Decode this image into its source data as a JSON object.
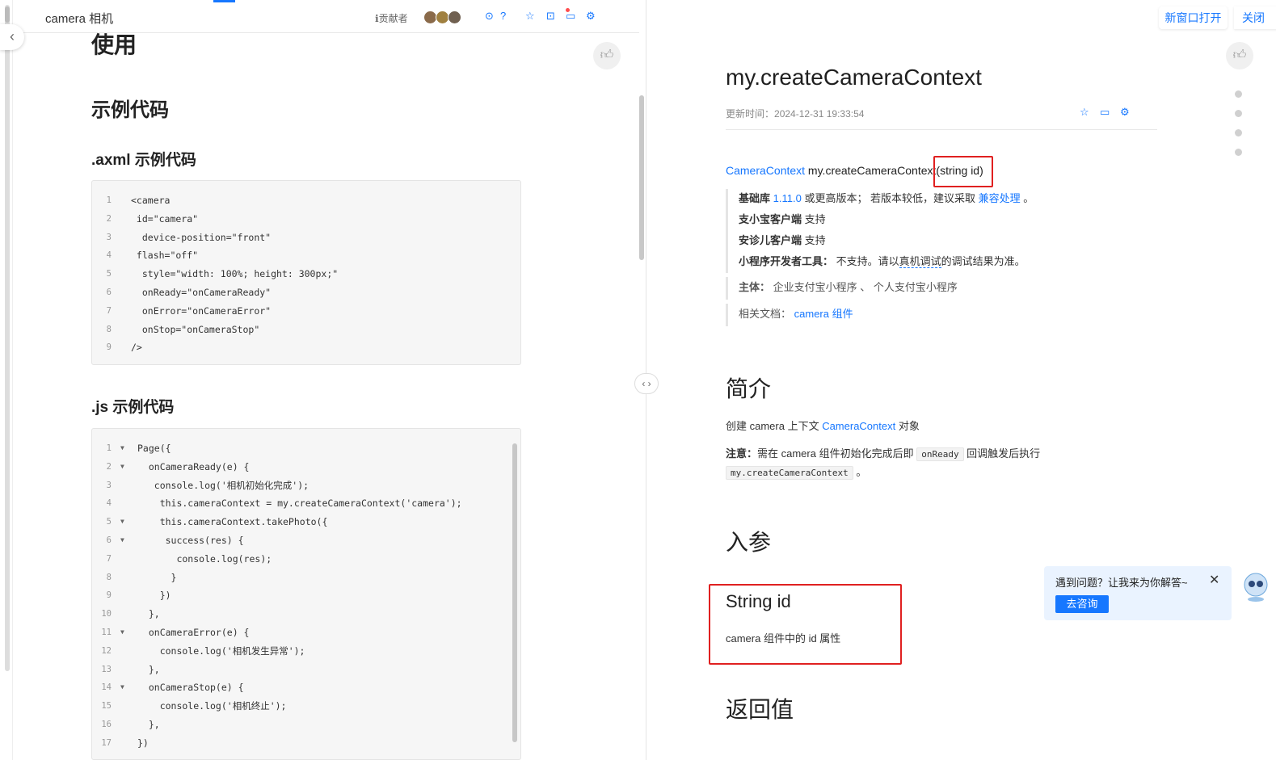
{
  "left": {
    "title": "camera 相机",
    "contributors_label": "贡献者",
    "heading_use": "使用",
    "heading_example": "示例代码",
    "heading_axml": ".axml 示例代码",
    "heading_js": ".js 示例代码",
    "axml_code": [
      {
        "n": "1",
        "text": "<camera"
      },
      {
        "n": "2",
        "text": " id=\"camera\""
      },
      {
        "n": "3",
        "text": "  device-position=\"front\""
      },
      {
        "n": "4",
        "text": " flash=\"off\""
      },
      {
        "n": "5",
        "text": "  style=\"width: 100%; height: 300px;\""
      },
      {
        "n": "6",
        "text": "  onReady=\"onCameraReady\""
      },
      {
        "n": "7",
        "text": "  onError=\"onCameraError\""
      },
      {
        "n": "8",
        "text": "  onStop=\"onCameraStop\""
      },
      {
        "n": "9",
        "text": "/>"
      }
    ],
    "js_code": [
      {
        "n": "1",
        "fold": true,
        "text": "Page({"
      },
      {
        "n": "2",
        "fold": true,
        "text": "  onCameraReady(e) {"
      },
      {
        "n": "3",
        "fold": false,
        "text": "   console.log('相机初始化完成');"
      },
      {
        "n": "4",
        "fold": false,
        "text": "    this.cameraContext = my.createCameraContext('camera');"
      },
      {
        "n": "5",
        "fold": true,
        "text": "    this.cameraContext.takePhoto({"
      },
      {
        "n": "6",
        "fold": true,
        "text": "     success(res) {"
      },
      {
        "n": "7",
        "fold": false,
        "text": "       console.log(res);"
      },
      {
        "n": "8",
        "fold": false,
        "text": "      }"
      },
      {
        "n": "9",
        "fold": false,
        "text": "    })"
      },
      {
        "n": "10",
        "fold": false,
        "text": "  },"
      },
      {
        "n": "11",
        "fold": true,
        "text": "  onCameraError(e) {"
      },
      {
        "n": "12",
        "fold": false,
        "text": "    console.log('相机发生异常');"
      },
      {
        "n": "13",
        "fold": false,
        "text": "  },"
      },
      {
        "n": "14",
        "fold": true,
        "text": "  onCameraStop(e) {"
      },
      {
        "n": "15",
        "fold": false,
        "text": "    console.log('相机终止');"
      },
      {
        "n": "16",
        "fold": false,
        "text": "  },"
      },
      {
        "n": "17",
        "fold": false,
        "text": "})"
      }
    ]
  },
  "right": {
    "new_window": "新窗口打开",
    "close": "关闭",
    "api_title": "my.createCameraContext",
    "updated_label": "更新时间：",
    "updated_value": "2024-12-31 19:33:54",
    "sig_type": "CameraContext",
    "sig_name": " my.createCameraContext",
    "sig_params": "(string id)",
    "info": {
      "lib_label": "基础库",
      "lib_version": "1.11.0",
      "lib_text": " 或更高版本； 若版本较低，建议采取 ",
      "lib_link": "兼容处理",
      "lib_end": " 。",
      "alipay_label": "支小宝客户端",
      "alipay_value": " 支持",
      "anzhen_label": "安诊儿客户端",
      "anzhen_value": " 支持",
      "devtool_label": "小程序开发者工具：",
      "devtool_value_a": " 不支持。请以",
      "devtool_value_link": "真机调试",
      "devtool_value_b": "的调试结果为准。",
      "subject_label": "主体：",
      "subject_value": " 企业支付宝小程序 、 个人支付宝小程序",
      "related_label": "相关文档：",
      "related_link": "camera 组件"
    },
    "intro_heading": "简介",
    "intro_a": "创建 camera 上下文 ",
    "intro_link": "CameraContext",
    "intro_b": " 对象",
    "note_label": "注意：",
    "note_a": "需在 camera 组件初始化完成后即 ",
    "note_code1": "onReady",
    "note_b": " 回调触发后执行",
    "note_code2": "my.createCameraContext",
    "note_end": " 。",
    "params_heading": "入参",
    "param_name": "String id",
    "param_desc": "camera 组件中的 id 属性",
    "return_heading": "返回值",
    "help_text": "遇到问题？让我来为你解答~",
    "help_button": "去咨询"
  },
  "colors": {
    "accent": "#1677ff",
    "highlight": "#e02020"
  }
}
